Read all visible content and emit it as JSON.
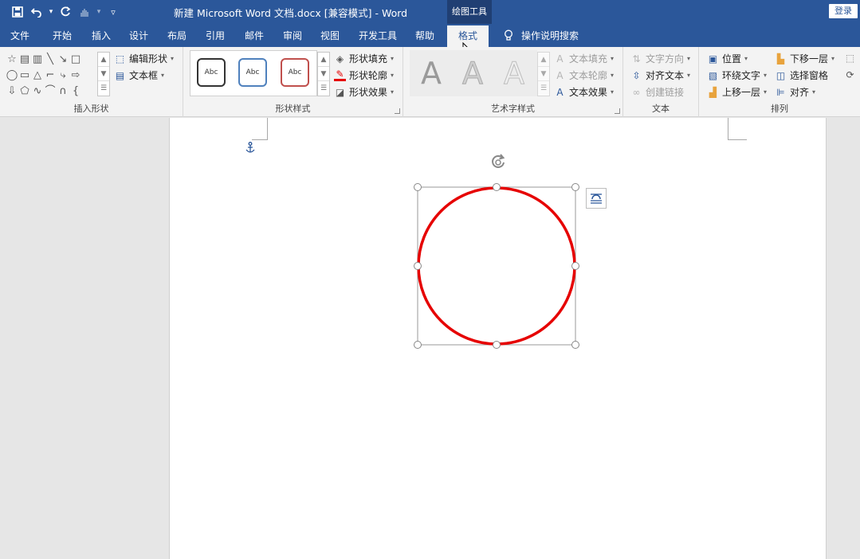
{
  "window": {
    "title": "新建 Microsoft Word 文档.docx [兼容模式]  -  Word",
    "context_tab_group": "绘图工具",
    "login_button": "登录"
  },
  "tabs": [
    "文件",
    "开始",
    "插入",
    "设计",
    "布局",
    "引用",
    "邮件",
    "审阅",
    "视图",
    "开发工具",
    "帮助",
    "格式"
  ],
  "active_tab": "格式",
  "tell_me": "操作说明搜索",
  "ribbon": {
    "insert_shapes": {
      "label": "插入形状",
      "edit_shape": "编辑形状",
      "text_box": "文本框"
    },
    "shape_styles": {
      "label": "形状样式",
      "presets": [
        {
          "text": "Abc",
          "color": "#333333"
        },
        {
          "text": "Abc",
          "color": "#4f81bd"
        },
        {
          "text": "Abc",
          "color": "#c0504d"
        }
      ],
      "fill": "形状填充",
      "outline": "形状轮廓",
      "effects": "形状效果"
    },
    "wordart_styles": {
      "label": "艺术字样式",
      "sample": "A",
      "text_fill": "文本填充",
      "text_outline": "文本轮廓",
      "text_effects": "文本效果"
    },
    "text": {
      "label": "文本",
      "direction": "文字方向",
      "align_text": "对齐文本",
      "create_link": "创建链接"
    },
    "arrange": {
      "label": "排列",
      "position": "位置",
      "wrap_text": "环绕文字",
      "bring_forward": "上移一层",
      "send_backward": "下移一层",
      "selection_pane": "选择窗格",
      "align": "对齐"
    }
  },
  "shape": {
    "type": "circle",
    "outline_color": "#e60000"
  },
  "colors": {
    "accent": "#2b579a",
    "context_tab": "#203f73",
    "ribbon_bg": "#f3f3f3"
  }
}
